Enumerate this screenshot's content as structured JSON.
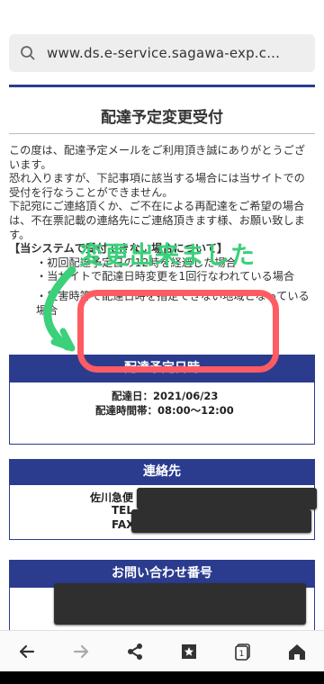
{
  "browser": {
    "url": "www.ds.e-service.sagawa-exp.c..."
  },
  "page": {
    "title": "配達予定変更受付",
    "intro": [
      "この度は、配達予定メールをご利用頂き誠にありがとうございます。",
      "恐れ入りますが、下記事項に該当する場合には当サイトでの受付を行なうことができません。",
      "下記宛にご連絡頂くか、ご不在による再配達をご希望の場合は、不在票記載の連絡先にご連絡頂きます様、お願い致します。"
    ],
    "notice_heading": "【当システムで受付できない場合について】",
    "notice_items": [
      "・初回配達予定日の12時を経過した場合",
      "・当サイトで配達日時変更を1回行なわれている場合",
      "・災害時等で配達日時を指定できない地域となっている場合"
    ],
    "schedule": {
      "heading": "配達予定日時",
      "date_label": "配達日：",
      "date_value": "2021/06/23",
      "time_label": "配達時間帯：",
      "time_value": "08:00～12:00"
    },
    "contact": {
      "heading": "連絡先",
      "company": "佐川急便",
      "tel_label": "TEL",
      "fax_label": "FAX"
    },
    "inquiry": {
      "heading": "お問い合わせ番号"
    }
  },
  "annotation": {
    "handwritten_text": "変更出来ました",
    "color_green": "#3bd07a",
    "color_red": "#ff5b62"
  },
  "navbar": {
    "tab_count": "1"
  },
  "colors": {
    "accent": "#2b3c8f"
  }
}
